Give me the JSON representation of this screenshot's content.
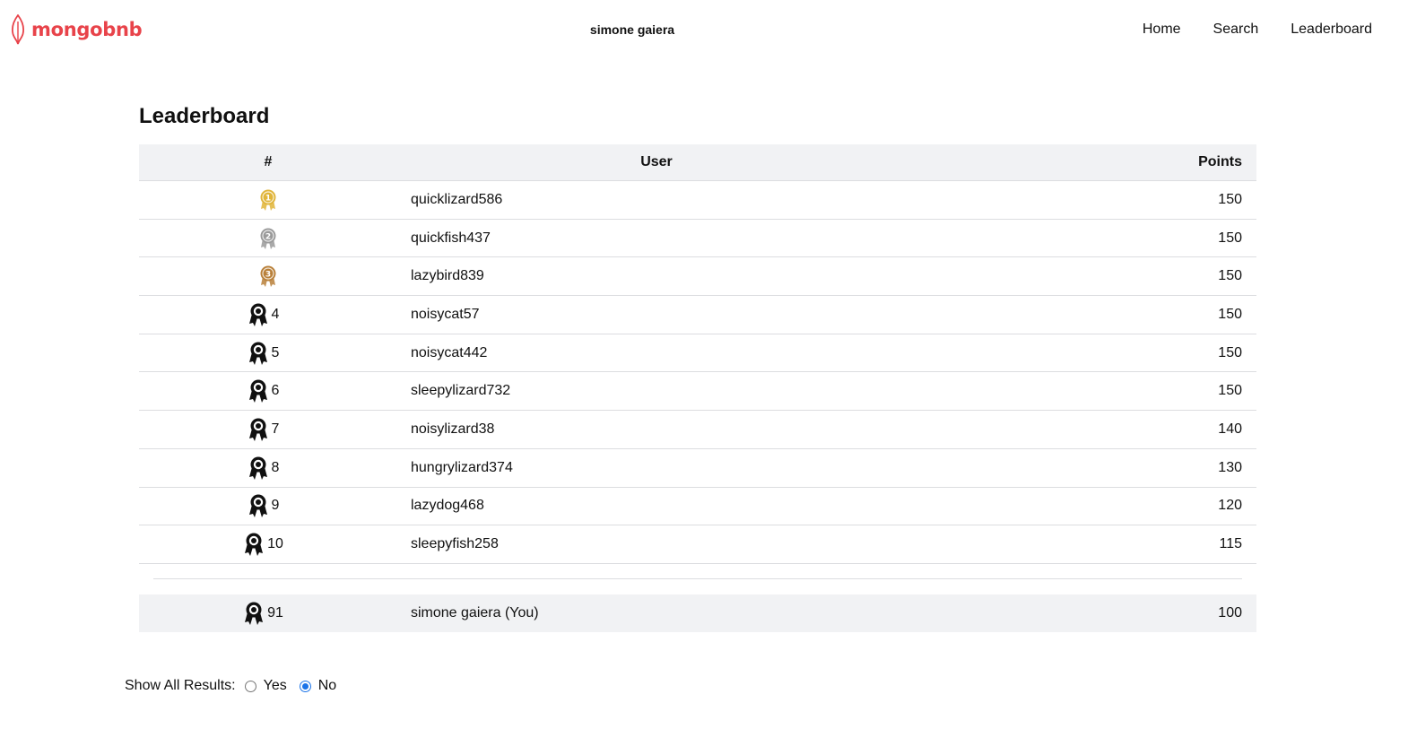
{
  "brand": {
    "name": "mongobnb",
    "color": "#e8434a"
  },
  "nav": {
    "current_user": "simone gaiera",
    "links": [
      "Home",
      "Search",
      "Leaderboard"
    ]
  },
  "leaderboard": {
    "title": "Leaderboard",
    "columns": {
      "rank": "#",
      "user": "User",
      "points": "Points"
    },
    "rows": [
      {
        "rank": "1",
        "user": "quicklizard586",
        "points": "150",
        "medal": "gold"
      },
      {
        "rank": "2",
        "user": "quickfish437",
        "points": "150",
        "medal": "silver"
      },
      {
        "rank": "3",
        "user": "lazybird839",
        "points": "150",
        "medal": "bronze"
      },
      {
        "rank": "4",
        "user": "noisycat57",
        "points": "150",
        "medal": "ribbon"
      },
      {
        "rank": "5",
        "user": "noisycat442",
        "points": "150",
        "medal": "ribbon"
      },
      {
        "rank": "6",
        "user": "sleepylizard732",
        "points": "150",
        "medal": "ribbon"
      },
      {
        "rank": "7",
        "user": "noisylizard38",
        "points": "140",
        "medal": "ribbon"
      },
      {
        "rank": "8",
        "user": "hungrylizard374",
        "points": "130",
        "medal": "ribbon"
      },
      {
        "rank": "9",
        "user": "lazydog468",
        "points": "120",
        "medal": "ribbon"
      },
      {
        "rank": "10",
        "user": "sleepyfish258",
        "points": "115",
        "medal": "ribbon"
      }
    ],
    "you": {
      "rank": "91",
      "user": "simone gaiera (You)",
      "points": "100",
      "medal": "ribbon"
    }
  },
  "filter": {
    "label": "Show All Results:",
    "options": [
      {
        "label": "Yes",
        "checked": false
      },
      {
        "label": "No",
        "checked": true
      }
    ]
  },
  "medal_colors": {
    "gold": "#e0b53a",
    "silver": "#9a9a9a",
    "bronze": "#b9803a",
    "ribbon": "#111111"
  }
}
